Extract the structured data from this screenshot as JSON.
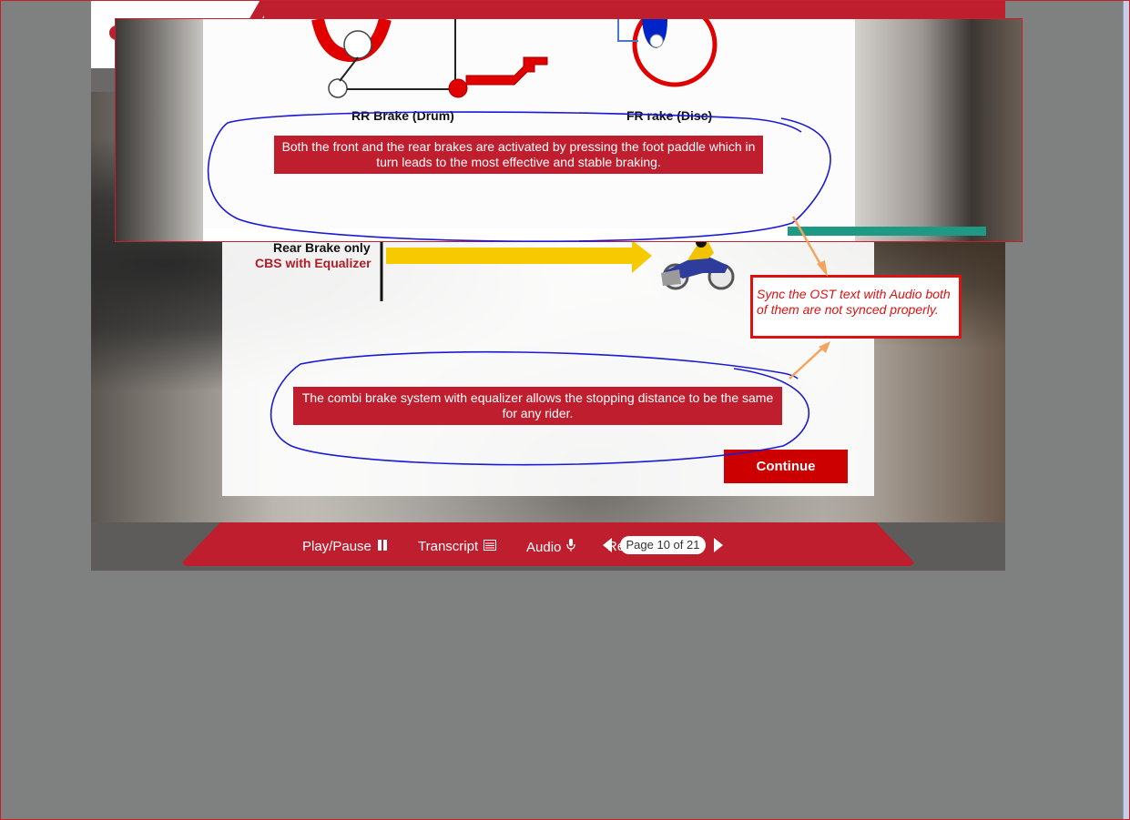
{
  "slide_top": {
    "rr_brake_label": "RR Brake (Drum)",
    "fr_brake_label": "FR rake (Disc)",
    "caption": "Both the front and the rear brakes are activated by pressing the foot paddle which in turn leads to the most effective and stable braking."
  },
  "slide_main": {
    "rear_brake_label": "Rear Brake only",
    "cbs_label": "CBS with Equalizer",
    "caption": "The combi brake system with equalizer allows the stopping distance to be the same for any rider.",
    "continue_label": "Continue"
  },
  "annotation": {
    "note": "Sync the OST text with Audio both of them are not synced properly."
  },
  "nav": {
    "play_pause": "Play/Pause",
    "transcript": "Transcript",
    "audio": "Audio",
    "replay": "Replay",
    "page_indicator": "Page 10 of 21"
  },
  "colors": {
    "brand_red": "#be1e2d",
    "annotation_blue": "#1a1ad6",
    "annotation_orange": "#f4a460",
    "note_red": "#dd1111"
  }
}
